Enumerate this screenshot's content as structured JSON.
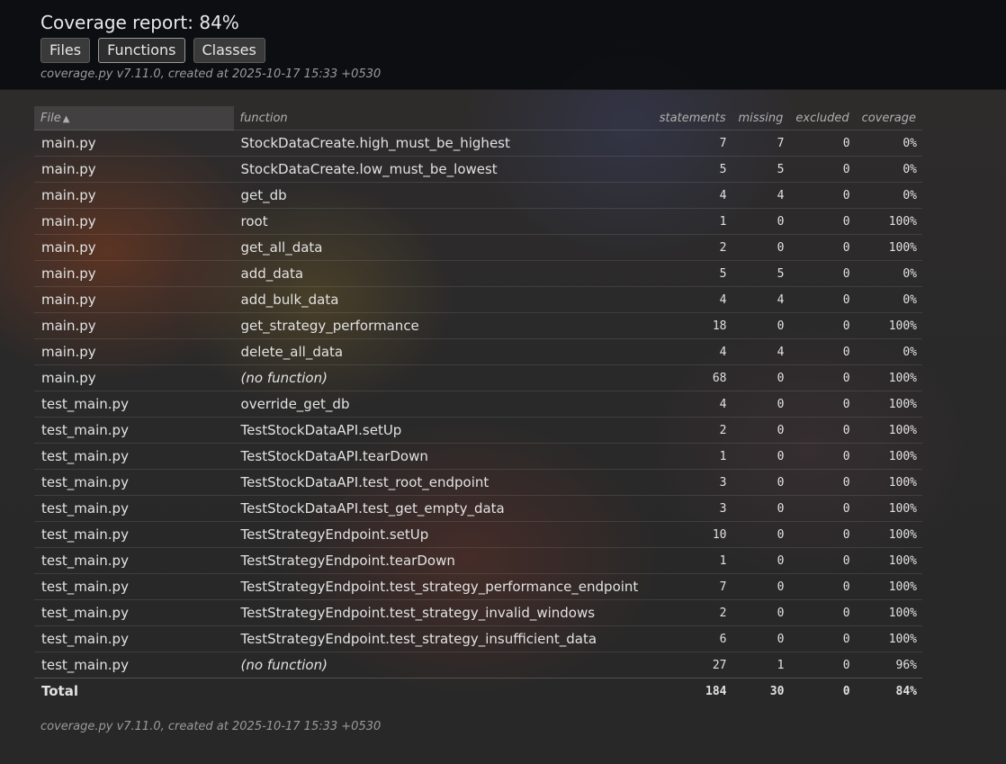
{
  "header": {
    "title": "Coverage report: 84%",
    "tabs": [
      {
        "label": "Files",
        "active": false
      },
      {
        "label": "Functions",
        "active": true
      },
      {
        "label": "Classes",
        "active": false
      }
    ],
    "created": "coverage.py v7.11.0, created at 2025-10-17 15:33 +0530"
  },
  "table": {
    "columns": {
      "file": "File",
      "function": "function",
      "statements": "statements",
      "missing": "missing",
      "excluded": "excluded",
      "coverage": "coverage"
    },
    "sort_indicator": "▲",
    "rows": [
      {
        "file": "main.py",
        "function": "StockDataCreate.high_must_be_highest",
        "statements": "7",
        "missing": "7",
        "excluded": "0",
        "coverage": "0%"
      },
      {
        "file": "main.py",
        "function": "StockDataCreate.low_must_be_lowest",
        "statements": "5",
        "missing": "5",
        "excluded": "0",
        "coverage": "0%"
      },
      {
        "file": "main.py",
        "function": "get_db",
        "statements": "4",
        "missing": "4",
        "excluded": "0",
        "coverage": "0%"
      },
      {
        "file": "main.py",
        "function": "root",
        "statements": "1",
        "missing": "0",
        "excluded": "0",
        "coverage": "100%"
      },
      {
        "file": "main.py",
        "function": "get_all_data",
        "statements": "2",
        "missing": "0",
        "excluded": "0",
        "coverage": "100%"
      },
      {
        "file": "main.py",
        "function": "add_data",
        "statements": "5",
        "missing": "5",
        "excluded": "0",
        "coverage": "0%"
      },
      {
        "file": "main.py",
        "function": "add_bulk_data",
        "statements": "4",
        "missing": "4",
        "excluded": "0",
        "coverage": "0%"
      },
      {
        "file": "main.py",
        "function": "get_strategy_performance",
        "statements": "18",
        "missing": "0",
        "excluded": "0",
        "coverage": "100%"
      },
      {
        "file": "main.py",
        "function": "delete_all_data",
        "statements": "4",
        "missing": "4",
        "excluded": "0",
        "coverage": "0%"
      },
      {
        "file": "main.py",
        "function": "(no function)",
        "statements": "68",
        "missing": "0",
        "excluded": "0",
        "coverage": "100%"
      },
      {
        "file": "test_main.py",
        "function": "override_get_db",
        "statements": "4",
        "missing": "0",
        "excluded": "0",
        "coverage": "100%"
      },
      {
        "file": "test_main.py",
        "function": "TestStockDataAPI.setUp",
        "statements": "2",
        "missing": "0",
        "excluded": "0",
        "coverage": "100%"
      },
      {
        "file": "test_main.py",
        "function": "TestStockDataAPI.tearDown",
        "statements": "1",
        "missing": "0",
        "excluded": "0",
        "coverage": "100%"
      },
      {
        "file": "test_main.py",
        "function": "TestStockDataAPI.test_root_endpoint",
        "statements": "3",
        "missing": "0",
        "excluded": "0",
        "coverage": "100%"
      },
      {
        "file": "test_main.py",
        "function": "TestStockDataAPI.test_get_empty_data",
        "statements": "3",
        "missing": "0",
        "excluded": "0",
        "coverage": "100%"
      },
      {
        "file": "test_main.py",
        "function": "TestStrategyEndpoint.setUp",
        "statements": "10",
        "missing": "0",
        "excluded": "0",
        "coverage": "100%"
      },
      {
        "file": "test_main.py",
        "function": "TestStrategyEndpoint.tearDown",
        "statements": "1",
        "missing": "0",
        "excluded": "0",
        "coverage": "100%"
      },
      {
        "file": "test_main.py",
        "function": "TestStrategyEndpoint.test_strategy_performance_endpoint",
        "statements": "7",
        "missing": "0",
        "excluded": "0",
        "coverage": "100%"
      },
      {
        "file": "test_main.py",
        "function": "TestStrategyEndpoint.test_strategy_invalid_windows",
        "statements": "2",
        "missing": "0",
        "excluded": "0",
        "coverage": "100%"
      },
      {
        "file": "test_main.py",
        "function": "TestStrategyEndpoint.test_strategy_insufficient_data",
        "statements": "6",
        "missing": "0",
        "excluded": "0",
        "coverage": "100%"
      },
      {
        "file": "test_main.py",
        "function": "(no function)",
        "statements": "27",
        "missing": "1",
        "excluded": "0",
        "coverage": "96%"
      }
    ],
    "total": {
      "label": "Total",
      "statements": "184",
      "missing": "30",
      "excluded": "0",
      "coverage": "84%"
    }
  },
  "footer": {
    "created": "coverage.py v7.11.0, created at 2025-10-17 15:33 +0530"
  }
}
